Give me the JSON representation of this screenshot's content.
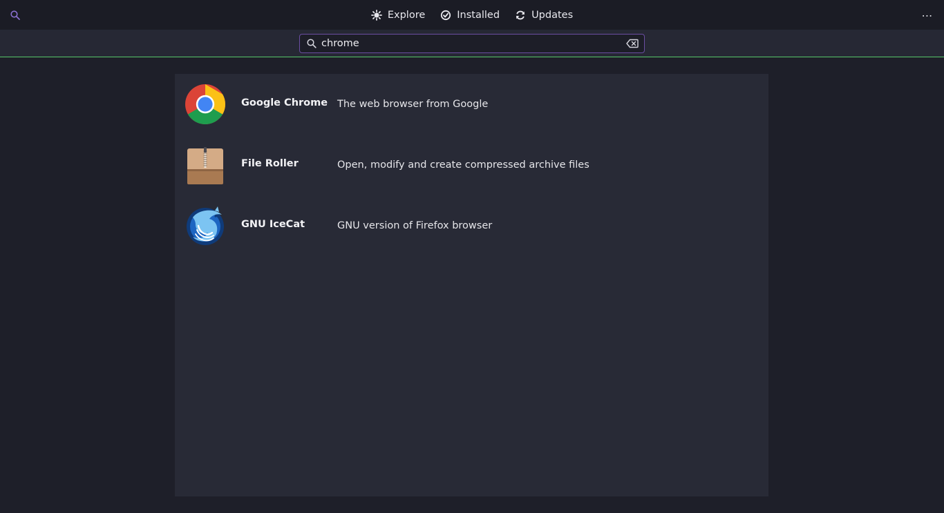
{
  "header": {
    "search_icon": "search-icon",
    "tabs": [
      {
        "label": "Explore",
        "icon": "explore-icon"
      },
      {
        "label": "Installed",
        "icon": "check-circle-icon"
      },
      {
        "label": "Updates",
        "icon": "refresh-icon"
      }
    ],
    "menu_label": "⋯"
  },
  "search": {
    "value": "chrome",
    "accent": "#6b4ea3",
    "progress_color": "#57c96a"
  },
  "results": [
    {
      "name": "Google Chrome",
      "summary": "The web browser from Google",
      "icon": "chrome-app-icon"
    },
    {
      "name": "File Roller",
      "summary": "Open, modify and create compressed archive files",
      "icon": "archive-app-icon"
    },
    {
      "name": "GNU IceCat",
      "summary": "GNU version of Firefox browser",
      "icon": "icecat-app-icon"
    }
  ]
}
